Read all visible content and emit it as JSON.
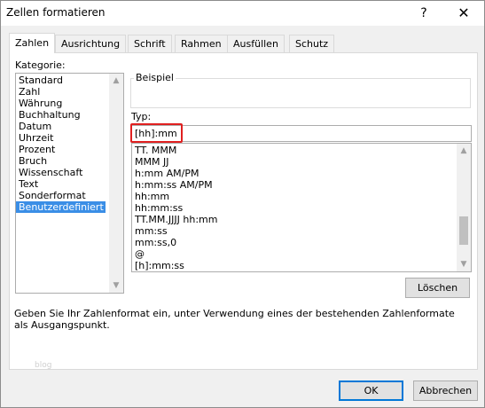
{
  "window": {
    "title": "Zellen formatieren",
    "help_glyph": "?",
    "close_glyph": "✕"
  },
  "tabs": [
    {
      "label": "Zahlen",
      "active": true
    },
    {
      "label": "Ausrichtung",
      "active": false
    },
    {
      "label": "Schrift",
      "active": false
    },
    {
      "label": "Rahmen",
      "active": false
    },
    {
      "label": "Ausfüllen",
      "active": false
    },
    {
      "label": "Schutz",
      "active": false
    }
  ],
  "category": {
    "label": "Kategorie:",
    "items": [
      "Standard",
      "Zahl",
      "Währung",
      "Buchhaltung",
      "Datum",
      "Uhrzeit",
      "Prozent",
      "Bruch",
      "Wissenschaft",
      "Text",
      "Sonderformat",
      "Benutzerdefiniert"
    ],
    "selected": "Benutzerdefiniert"
  },
  "sample": {
    "label": "Beispiel",
    "value": ""
  },
  "type": {
    "label": "Typ:",
    "value": "[hh]:mm",
    "highlight_color": "#e02020",
    "items": [
      "TT. MMM",
      "MMM JJ",
      "h:mm AM/PM",
      "h:mm:ss AM/PM",
      "hh:mm",
      "hh:mm:ss",
      "TT.MM.JJJJ hh:mm",
      "mm:ss",
      "mm:ss,0",
      "@",
      "[h]:mm:ss"
    ]
  },
  "delete_button": "Löschen",
  "description": "Geben Sie Ihr Zahlenformat ein, unter Verwendung eines der bestehenden Zahlenformate als Ausgangspunkt.",
  "watermark": "blog",
  "footer": {
    "ok_label": "OK",
    "cancel_label": "Abbrechen"
  },
  "colors": {
    "selection": "#3a8ee6",
    "default_button_border": "#0078d7"
  }
}
